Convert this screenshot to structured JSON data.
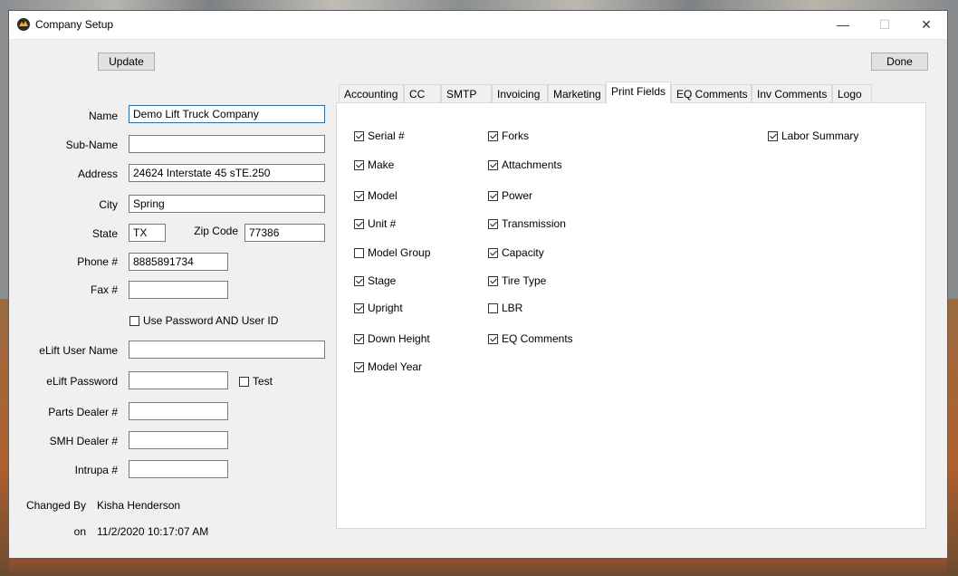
{
  "window": {
    "title": "Company Setup",
    "min_glyph": "—",
    "max_glyph": "☐",
    "close_glyph": "✕"
  },
  "toolbar": {
    "update_label": "Update",
    "done_label": "Done"
  },
  "form": {
    "name_label": "Name",
    "name_value": "Demo Lift Truck Company",
    "subname_label": "Sub-Name",
    "subname_value": "",
    "address_label": "Address",
    "address_value": "24624 Interstate 45 sTE.250",
    "city_label": "City",
    "city_value": "Spring",
    "state_label": "State",
    "state_value": "TX",
    "zip_label": "Zip Code",
    "zip_value": "77386",
    "phone_label": "Phone #",
    "phone_value": "8885891734",
    "fax_label": "Fax #",
    "fax_value": "",
    "use_password_label": "Use Password AND User ID",
    "elift_user_label": "eLift User Name",
    "elift_user_value": "",
    "elift_password_label": "eLift Password",
    "elift_password_value": "",
    "test_label": "Test",
    "parts_dealer_label": "Parts Dealer #",
    "parts_dealer_value": "",
    "smh_dealer_label": "SMH Dealer #",
    "smh_dealer_value": "",
    "intrupa_label": "Intrupa #",
    "intrupa_value": "",
    "changed_by_label": "Changed By",
    "changed_by_value": "Kisha Henderson",
    "on_label": "on",
    "on_value": "11/2/2020 10:17:07 AM"
  },
  "tabs": [
    "Accounting",
    "CC",
    "SMTP",
    "Invoicing",
    "Marketing",
    "Print Fields",
    "EQ Comments",
    "Inv Comments",
    "Logo"
  ],
  "active_tab": "Print Fields",
  "print_fields": {
    "col1": [
      {
        "label": "Serial #",
        "checked": true
      },
      {
        "label": "Make",
        "checked": true
      },
      {
        "label": "Model",
        "checked": true
      },
      {
        "label": "Unit #",
        "checked": true
      },
      {
        "label": "Model Group",
        "checked": false
      },
      {
        "label": "Stage",
        "checked": true
      },
      {
        "label": "Upright",
        "checked": true
      },
      {
        "label": "Down Height",
        "checked": true
      },
      {
        "label": "Model Year",
        "checked": true
      }
    ],
    "col2": [
      {
        "label": "Forks",
        "checked": true
      },
      {
        "label": "Attachments",
        "checked": true
      },
      {
        "label": "Power",
        "checked": true
      },
      {
        "label": "Transmission",
        "checked": true
      },
      {
        "label": "Capacity",
        "checked": true
      },
      {
        "label": "Tire Type",
        "checked": true
      },
      {
        "label": "LBR",
        "checked": false
      },
      {
        "label": "EQ Comments",
        "checked": true
      }
    ],
    "col3": [
      {
        "label": "Labor Summary",
        "checked": true
      }
    ]
  },
  "icons": {
    "app": "forklift-app-icon"
  }
}
